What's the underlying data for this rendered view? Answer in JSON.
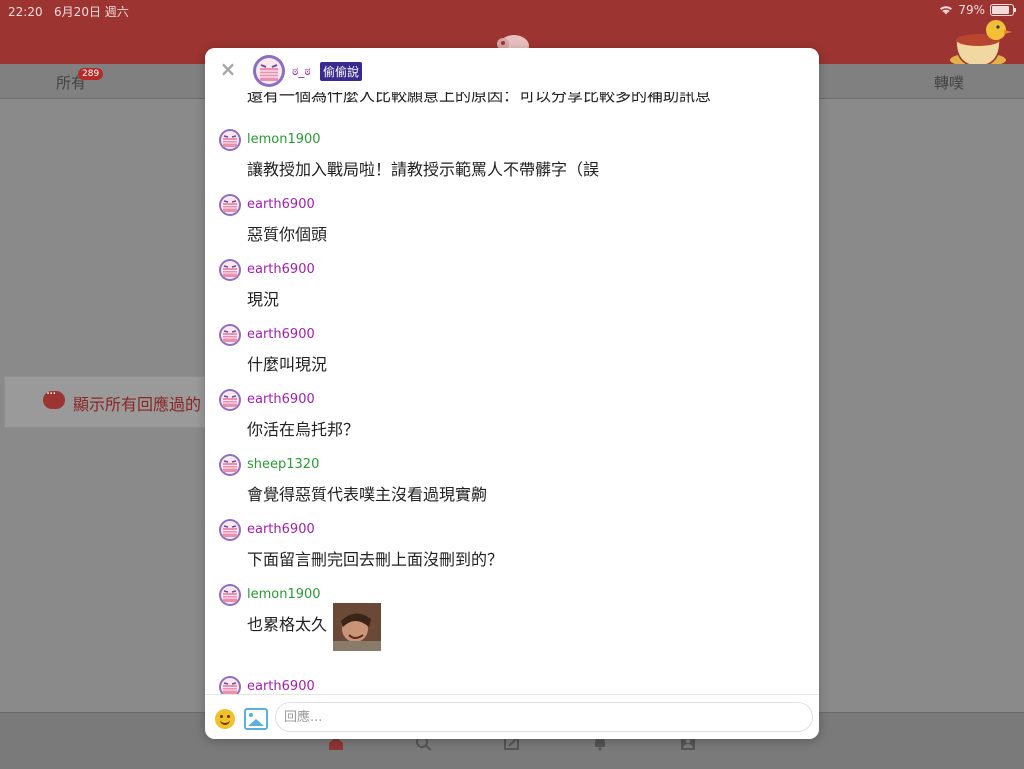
{
  "status_bar": {
    "time": "22:20",
    "date": "6月20日 週六",
    "battery": "79%",
    "battery_level": 0.79
  },
  "tabs": {
    "all_label": "所有",
    "all_badge": "289",
    "replurk_label": "轉噗"
  },
  "timeline": {
    "show_responded_label": "顯示所有回應過的"
  },
  "modal": {
    "close_icon": "close-icon",
    "poster_name": "ಠ_ಠ",
    "qualifier": "偷偷說",
    "partial_top_text": "還有一個為什麼人比較願意上的原因：可以分享比較多的補助訊息",
    "responses": [
      {
        "user": "lemon1900",
        "text": "讓教授加入戰局啦！請教授示範罵人不帶髒字（誤",
        "user_color": "#2a9a35"
      },
      {
        "user": "earth6900",
        "text": "惡質你個頭",
        "user_color": "#a01fae"
      },
      {
        "user": "earth6900",
        "text": "現況",
        "user_color": "#a01fae"
      },
      {
        "user": "earth6900",
        "text": "什麼叫現況",
        "user_color": "#a01fae"
      },
      {
        "user": "earth6900",
        "text": "你活在烏托邦？",
        "user_color": "#a01fae"
      },
      {
        "user": "sheep1320",
        "text": "會覺得惡質代表噗主沒看過現實齁",
        "user_color": "#2a9a35"
      },
      {
        "user": "earth6900",
        "text": "下面留言刪完回去刪上面沒刪到的？",
        "user_color": "#a01fae"
      },
      {
        "user": "lemon1900",
        "text": "也累格太久",
        "user_color": "#2a9a35"
      },
      {
        "user": "earth6900",
        "text": "",
        "user_color": "#a01fae"
      }
    ]
  },
  "composer": {
    "placeholder": "回應..."
  },
  "colors": {
    "brand_red": "#9c3431",
    "user_green": "#2a9a35",
    "user_purple": "#a01fae",
    "qualifier_bg": "#3a2a90"
  }
}
